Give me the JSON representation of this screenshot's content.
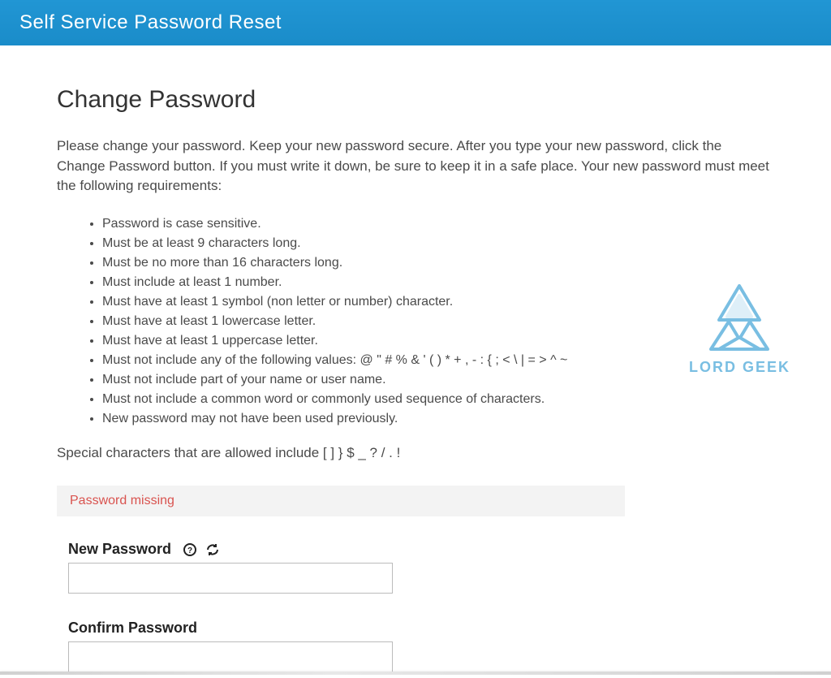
{
  "header": {
    "title": "Self Service Password Reset"
  },
  "page": {
    "title": "Change Password",
    "intro": "Please change your password. Keep your new password secure. After you type your new password, click the Change Password button. If you must write it down, be sure to keep it in a safe place. Your new password must meet the following requirements:",
    "requirements": [
      "Password is case sensitive.",
      "Must be at least 9 characters long.",
      "Must be no more than 16 characters long.",
      "Must include at least 1 number.",
      "Must have at least 1 symbol (non letter or number) character.",
      "Must have at least 1 lowercase letter.",
      "Must have at least 1 uppercase letter.",
      "Must not include any of the following values: @ \" # % & ' ( ) * + , - : { ; < \\ | = > ^ ~",
      "Must not include part of your name or user name.",
      "Must not include a common word or commonly used sequence of characters.",
      "New password may not have been used previously."
    ],
    "allowed_chars": "Special characters that are allowed include [ ] } $ _ ? / . !",
    "error": "Password missing"
  },
  "form": {
    "new_password": {
      "label": "New Password",
      "value": ""
    },
    "confirm_password": {
      "label": "Confirm Password",
      "value": ""
    }
  },
  "watermark": {
    "text": "LORD GEEK"
  }
}
